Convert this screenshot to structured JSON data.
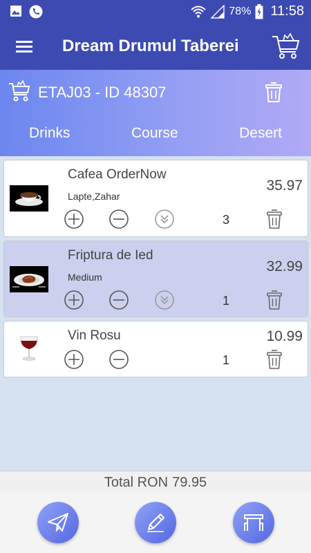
{
  "status_bar": {
    "battery": "78%",
    "time": "11:58"
  },
  "app_bar": {
    "title": "Dream Drumul Taberei"
  },
  "order": {
    "title": "ETAJ03 - ID 48307"
  },
  "tabs": [
    {
      "label": "Drinks"
    },
    {
      "label": "Course"
    },
    {
      "label": "Desert"
    }
  ],
  "items": [
    {
      "name": "Cafea OrderNow",
      "note": "Lapte,Zahar",
      "price": "35.97",
      "quantity": "3",
      "selected": false
    },
    {
      "name": "Friptura de Ied",
      "note": "Medium",
      "price": "32.99",
      "quantity": "1",
      "selected": true
    },
    {
      "name": "Vin Rosu",
      "note": "",
      "price": "10.99",
      "quantity": "1",
      "selected": false
    }
  ],
  "total": {
    "label": "Total RON",
    "value": "79.95"
  },
  "colors": {
    "primary": "#3c4ab2",
    "gradient_start": "#6c86f0",
    "gradient_end": "#b1aaf6",
    "selected_row": "#ccd0ee"
  },
  "icons": {
    "status_left": [
      "gallery-icon",
      "phone-icon"
    ],
    "status_right": [
      "wifi-icon",
      "signal-icon",
      "battery-icon"
    ],
    "bottom_actions": [
      "send-icon",
      "edit-icon",
      "table-icon"
    ]
  }
}
